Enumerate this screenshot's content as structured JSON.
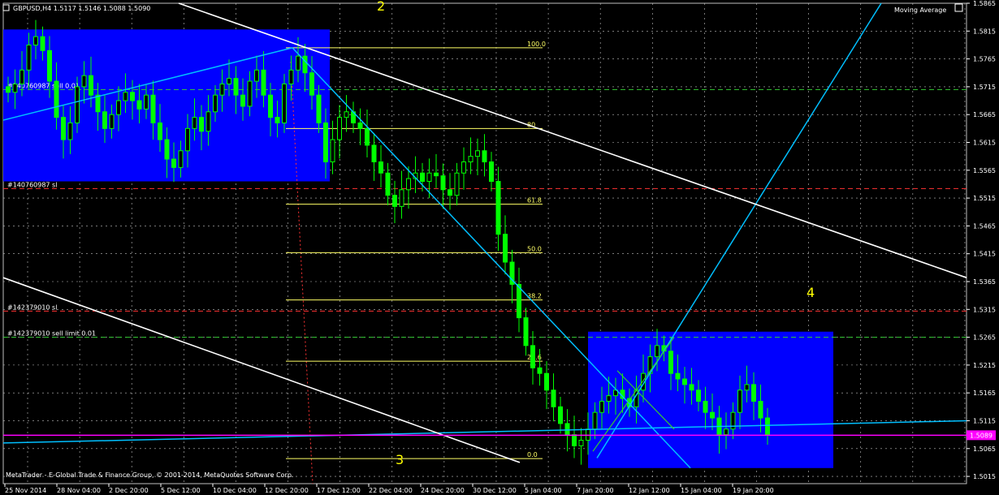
{
  "header": {
    "symbol_info": "GBPUSD,H4  1.5117  1.5146  1.5088  1.5090",
    "indicator": "Moving Average"
  },
  "footer": {
    "copyright": "MetaTrader - E-Global Trade & Finance Group, © 2001-2014, MetaQuotes Software Corp."
  },
  "colors": {
    "background": "#000000",
    "grid": "#c0c0c0",
    "candle": "#00ff00",
    "box": "#0000ff",
    "fib": "#ffff66",
    "channel": "#ffffff",
    "trendline": "#00bfff",
    "ma_line": "#00bfff",
    "bid_line": "#ff00ff",
    "sl_line": "#ff3333",
    "order_line": "#33cc33"
  },
  "chart_data": {
    "type": "candlestick",
    "symbol": "GBPUSD",
    "timeframe": "H4",
    "ylim": [
      1.5002,
      1.5865
    ],
    "y_ticks": [
      "1.5865",
      "1.5815",
      "1.5765",
      "1.5715",
      "1.5665",
      "1.5615",
      "1.5565",
      "1.5515",
      "1.5465",
      "1.5415",
      "1.5365",
      "1.5315",
      "1.5265",
      "1.5215",
      "1.5165",
      "1.5115",
      "1.5065",
      "1.5015"
    ],
    "x_ticks": [
      "25 Nov 2014",
      "28 Nov 04:00",
      "2 Dec 20:00",
      "5 Dec 12:00",
      "10 Dec 04:00",
      "12 Dec 20:00",
      "17 Dec 12:00",
      "22 Dec 04:00",
      "24 Dec 20:00",
      "30 Dec 12:00",
      "5 Jan 04:00",
      "7 Jan 20:00",
      "12 Jan 12:00",
      "15 Jan 04:00",
      "19 Jan 20:00"
    ],
    "current_price": "1.5089",
    "close_series": [
      1.5705,
      1.572,
      1.5745,
      1.579,
      1.5805,
      1.578,
      1.5725,
      1.566,
      1.562,
      1.565,
      1.5715,
      1.5735,
      1.57,
      1.567,
      1.564,
      1.5665,
      1.569,
      1.5705,
      1.569,
      1.5675,
      1.57,
      1.565,
      1.562,
      1.5585,
      1.557,
      1.56,
      1.564,
      1.566,
      1.5635,
      1.567,
      1.57,
      1.572,
      1.573,
      1.57,
      1.568,
      1.5725,
      1.5745,
      1.57,
      1.566,
      1.565,
      1.572,
      1.5745,
      1.577,
      1.574,
      1.57,
      1.565,
      1.558,
      1.562,
      1.566,
      1.567,
      1.565,
      1.564,
      1.561,
      1.558,
      1.556,
      1.552,
      1.55,
      1.553,
      1.555,
      1.556,
      1.5545,
      1.556,
      1.5555,
      1.553,
      1.552,
      1.556,
      1.558,
      1.559,
      1.56,
      1.558,
      1.5545,
      1.545,
      1.54,
      1.536,
      1.53,
      1.525,
      1.521,
      1.52,
      1.517,
      1.514,
      1.511,
      1.509,
      1.507,
      1.508,
      1.51,
      1.513,
      1.515,
      1.516,
      1.517,
      1.5155,
      1.514,
      1.517,
      1.52,
      1.523,
      1.525,
      1.524,
      1.52,
      1.519,
      1.518,
      1.517,
      1.515,
      1.513,
      1.512,
      1.509,
      1.51,
      1.513,
      1.517,
      1.518,
      1.515,
      1.512,
      1.509
    ],
    "ma_line": {
      "start": 1.5065,
      "end": 1.5105
    },
    "bid_line": 1.5089,
    "horizontal_levels": [
      {
        "label": "#140760987 sell 0.01",
        "price": 1.571,
        "kind": "order"
      },
      {
        "label": "#140760987 sl",
        "price": 1.5532,
        "kind": "sl"
      },
      {
        "label": "#142379010 sl",
        "price": 1.5312,
        "kind": "sl"
      },
      {
        "label": "#142379010 sell limit 0.01",
        "price": 1.5265,
        "kind": "order"
      }
    ],
    "fibonacci": [
      {
        "label": "100.0",
        "price": 1.5785
      },
      {
        "label": "80",
        "price": 1.564
      },
      {
        "label": "61.8",
        "price": 1.5504
      },
      {
        "label": "50.0",
        "price": 1.5417
      },
      {
        "label": "38.2",
        "price": 1.5332
      },
      {
        "label": "23.6",
        "price": 1.5222
      },
      {
        "label": "0.0",
        "price": 1.5047
      }
    ],
    "wave_labels": [
      "2",
      "3",
      "4"
    ],
    "grid": true
  }
}
